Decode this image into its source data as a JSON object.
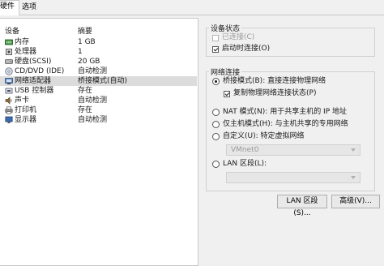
{
  "tabs": {
    "hardware": "硬件",
    "options": "选项"
  },
  "device_list": {
    "col_device": "设备",
    "col_summary": "摘要",
    "rows": [
      {
        "name": "内存",
        "summary": "1 GB",
        "icon": "memory-icon"
      },
      {
        "name": "处理器",
        "summary": "1",
        "icon": "processor-icon"
      },
      {
        "name": "硬盘(SCSI)",
        "summary": "20 GB",
        "icon": "hard-disk-icon"
      },
      {
        "name": "CD/DVD (IDE)",
        "summary": "自动检测",
        "icon": "cd-dvd-icon"
      },
      {
        "name": "网络适配器",
        "summary": "桥接模式(自动)",
        "icon": "network-adapter-icon"
      },
      {
        "name": "USB 控制器",
        "summary": "存在",
        "icon": "usb-icon"
      },
      {
        "name": "声卡",
        "summary": "自动检测",
        "icon": "sound-card-icon"
      },
      {
        "name": "打印机",
        "summary": "存在",
        "icon": "printer-icon"
      },
      {
        "name": "显示器",
        "summary": "自动检测",
        "icon": "display-icon"
      }
    ]
  },
  "device_status": {
    "title": "设备状态",
    "connected": "已连接(C)",
    "connect_at_power_on": "启动时连接(O)"
  },
  "network": {
    "title": "网络连接",
    "bridged": "桥接模式(B): 直接连接物理网络",
    "replicate": "复制物理网络连接状态(P)",
    "nat": "NAT 模式(N): 用于共享主机的 IP 地址",
    "host_only": "仅主机模式(H): 与主机共享的专用网络",
    "custom": "自定义(U): 特定虚拟网络",
    "custom_value": "VMnet0",
    "lan_segment": "LAN 区段(L):",
    "lan_value": ""
  },
  "buttons": {
    "lan_segments": "LAN 区段(S)...",
    "advanced": "高级(V)..."
  }
}
